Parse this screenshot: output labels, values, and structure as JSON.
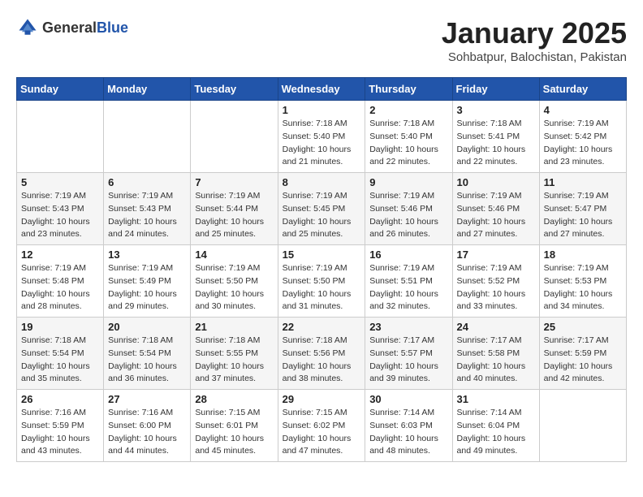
{
  "header": {
    "logo_general": "General",
    "logo_blue": "Blue",
    "month": "January 2025",
    "location": "Sohbatpur, Balochistan, Pakistan"
  },
  "days_of_week": [
    "Sunday",
    "Monday",
    "Tuesday",
    "Wednesday",
    "Thursday",
    "Friday",
    "Saturday"
  ],
  "weeks": [
    [
      {
        "day": "",
        "sunrise": "",
        "sunset": "",
        "daylight": ""
      },
      {
        "day": "",
        "sunrise": "",
        "sunset": "",
        "daylight": ""
      },
      {
        "day": "",
        "sunrise": "",
        "sunset": "",
        "daylight": ""
      },
      {
        "day": "1",
        "sunrise": "Sunrise: 7:18 AM",
        "sunset": "Sunset: 5:40 PM",
        "daylight": "Daylight: 10 hours and 21 minutes."
      },
      {
        "day": "2",
        "sunrise": "Sunrise: 7:18 AM",
        "sunset": "Sunset: 5:40 PM",
        "daylight": "Daylight: 10 hours and 22 minutes."
      },
      {
        "day": "3",
        "sunrise": "Sunrise: 7:18 AM",
        "sunset": "Sunset: 5:41 PM",
        "daylight": "Daylight: 10 hours and 22 minutes."
      },
      {
        "day": "4",
        "sunrise": "Sunrise: 7:19 AM",
        "sunset": "Sunset: 5:42 PM",
        "daylight": "Daylight: 10 hours and 23 minutes."
      }
    ],
    [
      {
        "day": "5",
        "sunrise": "Sunrise: 7:19 AM",
        "sunset": "Sunset: 5:43 PM",
        "daylight": "Daylight: 10 hours and 23 minutes."
      },
      {
        "day": "6",
        "sunrise": "Sunrise: 7:19 AM",
        "sunset": "Sunset: 5:43 PM",
        "daylight": "Daylight: 10 hours and 24 minutes."
      },
      {
        "day": "7",
        "sunrise": "Sunrise: 7:19 AM",
        "sunset": "Sunset: 5:44 PM",
        "daylight": "Daylight: 10 hours and 25 minutes."
      },
      {
        "day": "8",
        "sunrise": "Sunrise: 7:19 AM",
        "sunset": "Sunset: 5:45 PM",
        "daylight": "Daylight: 10 hours and 25 minutes."
      },
      {
        "day": "9",
        "sunrise": "Sunrise: 7:19 AM",
        "sunset": "Sunset: 5:46 PM",
        "daylight": "Daylight: 10 hours and 26 minutes."
      },
      {
        "day": "10",
        "sunrise": "Sunrise: 7:19 AM",
        "sunset": "Sunset: 5:46 PM",
        "daylight": "Daylight: 10 hours and 27 minutes."
      },
      {
        "day": "11",
        "sunrise": "Sunrise: 7:19 AM",
        "sunset": "Sunset: 5:47 PM",
        "daylight": "Daylight: 10 hours and 27 minutes."
      }
    ],
    [
      {
        "day": "12",
        "sunrise": "Sunrise: 7:19 AM",
        "sunset": "Sunset: 5:48 PM",
        "daylight": "Daylight: 10 hours and 28 minutes."
      },
      {
        "day": "13",
        "sunrise": "Sunrise: 7:19 AM",
        "sunset": "Sunset: 5:49 PM",
        "daylight": "Daylight: 10 hours and 29 minutes."
      },
      {
        "day": "14",
        "sunrise": "Sunrise: 7:19 AM",
        "sunset": "Sunset: 5:50 PM",
        "daylight": "Daylight: 10 hours and 30 minutes."
      },
      {
        "day": "15",
        "sunrise": "Sunrise: 7:19 AM",
        "sunset": "Sunset: 5:50 PM",
        "daylight": "Daylight: 10 hours and 31 minutes."
      },
      {
        "day": "16",
        "sunrise": "Sunrise: 7:19 AM",
        "sunset": "Sunset: 5:51 PM",
        "daylight": "Daylight: 10 hours and 32 minutes."
      },
      {
        "day": "17",
        "sunrise": "Sunrise: 7:19 AM",
        "sunset": "Sunset: 5:52 PM",
        "daylight": "Daylight: 10 hours and 33 minutes."
      },
      {
        "day": "18",
        "sunrise": "Sunrise: 7:19 AM",
        "sunset": "Sunset: 5:53 PM",
        "daylight": "Daylight: 10 hours and 34 minutes."
      }
    ],
    [
      {
        "day": "19",
        "sunrise": "Sunrise: 7:18 AM",
        "sunset": "Sunset: 5:54 PM",
        "daylight": "Daylight: 10 hours and 35 minutes."
      },
      {
        "day": "20",
        "sunrise": "Sunrise: 7:18 AM",
        "sunset": "Sunset: 5:54 PM",
        "daylight": "Daylight: 10 hours and 36 minutes."
      },
      {
        "day": "21",
        "sunrise": "Sunrise: 7:18 AM",
        "sunset": "Sunset: 5:55 PM",
        "daylight": "Daylight: 10 hours and 37 minutes."
      },
      {
        "day": "22",
        "sunrise": "Sunrise: 7:18 AM",
        "sunset": "Sunset: 5:56 PM",
        "daylight": "Daylight: 10 hours and 38 minutes."
      },
      {
        "day": "23",
        "sunrise": "Sunrise: 7:17 AM",
        "sunset": "Sunset: 5:57 PM",
        "daylight": "Daylight: 10 hours and 39 minutes."
      },
      {
        "day": "24",
        "sunrise": "Sunrise: 7:17 AM",
        "sunset": "Sunset: 5:58 PM",
        "daylight": "Daylight: 10 hours and 40 minutes."
      },
      {
        "day": "25",
        "sunrise": "Sunrise: 7:17 AM",
        "sunset": "Sunset: 5:59 PM",
        "daylight": "Daylight: 10 hours and 42 minutes."
      }
    ],
    [
      {
        "day": "26",
        "sunrise": "Sunrise: 7:16 AM",
        "sunset": "Sunset: 5:59 PM",
        "daylight": "Daylight: 10 hours and 43 minutes."
      },
      {
        "day": "27",
        "sunrise": "Sunrise: 7:16 AM",
        "sunset": "Sunset: 6:00 PM",
        "daylight": "Daylight: 10 hours and 44 minutes."
      },
      {
        "day": "28",
        "sunrise": "Sunrise: 7:15 AM",
        "sunset": "Sunset: 6:01 PM",
        "daylight": "Daylight: 10 hours and 45 minutes."
      },
      {
        "day": "29",
        "sunrise": "Sunrise: 7:15 AM",
        "sunset": "Sunset: 6:02 PM",
        "daylight": "Daylight: 10 hours and 47 minutes."
      },
      {
        "day": "30",
        "sunrise": "Sunrise: 7:14 AM",
        "sunset": "Sunset: 6:03 PM",
        "daylight": "Daylight: 10 hours and 48 minutes."
      },
      {
        "day": "31",
        "sunrise": "Sunrise: 7:14 AM",
        "sunset": "Sunset: 6:04 PM",
        "daylight": "Daylight: 10 hours and 49 minutes."
      },
      {
        "day": "",
        "sunrise": "",
        "sunset": "",
        "daylight": ""
      }
    ]
  ]
}
